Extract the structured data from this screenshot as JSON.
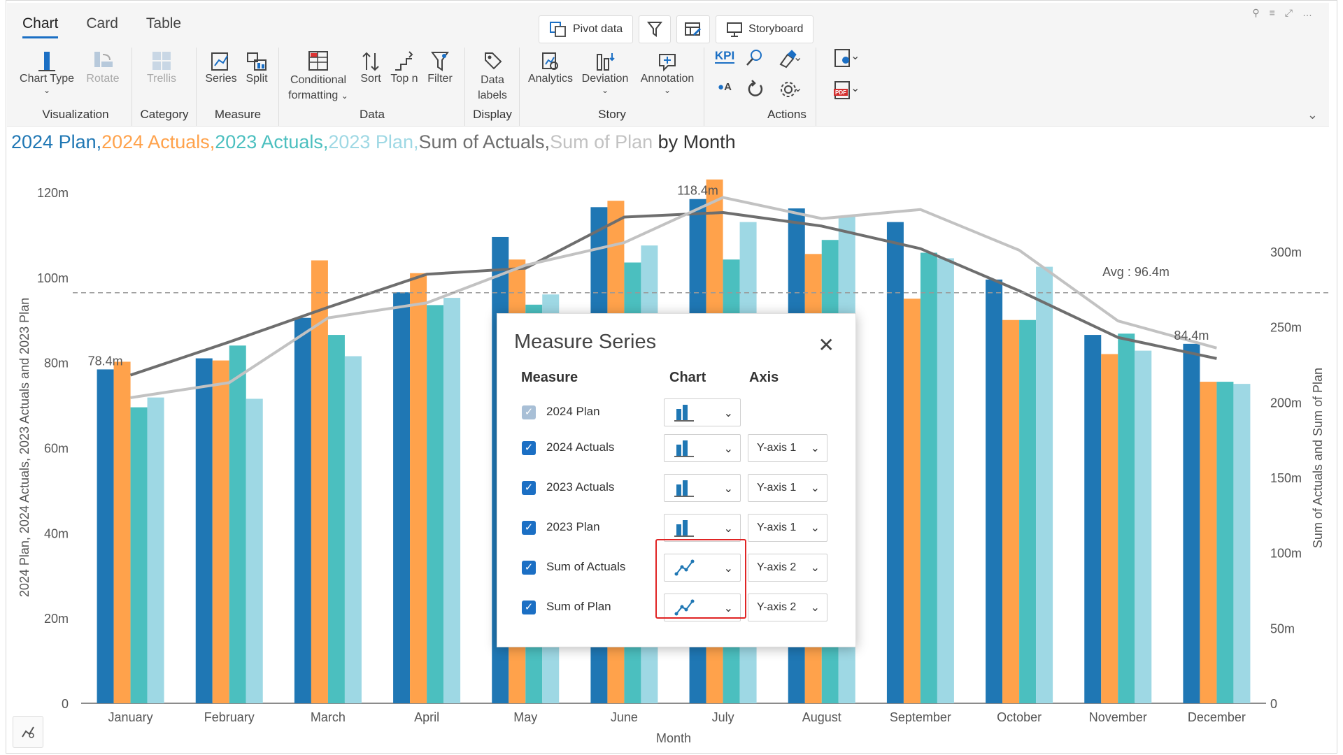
{
  "tabs": [
    "Chart",
    "Card",
    "Table"
  ],
  "top_buttons": {
    "pivot": "Pivot data",
    "storyboard": "Storyboard"
  },
  "ribbon": {
    "chart_type": "Chart Type",
    "rotate": "Rotate",
    "trellis": "Trellis",
    "series": "Series",
    "split": "Split",
    "conditional": "Conditional",
    "formatting": "formatting",
    "sort": "Sort",
    "topn": "Top n",
    "filter": "Filter",
    "data": "Data",
    "labels": "labels",
    "analytics": "Analytics",
    "deviation": "Deviation",
    "annotation": "Annotation",
    "kpi": "KPI",
    "groups": {
      "visualization": "Visualization",
      "category": "Category",
      "measure": "Measure",
      "data": "Data",
      "display": "Display",
      "story": "Story",
      "actions": "Actions"
    }
  },
  "title": {
    "p1": "2024 Plan,",
    "p2": "2024 Actuals,",
    "p3": "2023 Actuals,",
    "p4": "2023 Plan,",
    "p5": "Sum of Actuals,",
    "p6": "Sum of Plan",
    "p7": " by Month"
  },
  "colors": {
    "plan2024": "#1f77b4",
    "actuals2024": "#ffa24b",
    "actuals2023": "#4bbfbf",
    "plan2023": "#9ed8e4",
    "sum_actuals": "#6e6e6e",
    "sum_plan": "#c2c2c2",
    "accent": "#1b6fc4",
    "highlight": "#e02424"
  },
  "chart_data": {
    "type": "bar",
    "categories": [
      "January",
      "February",
      "March",
      "April",
      "May",
      "June",
      "July",
      "August",
      "September",
      "October",
      "November",
      "December"
    ],
    "series": [
      {
        "name": "2024 Plan",
        "axis": "y1",
        "values": [
          78.4,
          81,
          90.5,
          96.5,
          109.5,
          116.5,
          118.4,
          116.2,
          113,
          99.5,
          86.5,
          84.4
        ]
      },
      {
        "name": "2024 Actuals",
        "axis": "y1",
        "values": [
          80.2,
          80.5,
          104,
          101,
          104.2,
          118,
          123,
          105.5,
          95,
          90,
          82,
          75.5
        ]
      },
      {
        "name": "2023 Actuals",
        "axis": "y1",
        "values": [
          69.5,
          84,
          86.5,
          93.5,
          93.6,
          103.5,
          104.2,
          108.8,
          105.8,
          90,
          86.8,
          75.5
        ]
      },
      {
        "name": "2023 Plan",
        "axis": "y1",
        "values": [
          71.8,
          71.5,
          81.5,
          95.2,
          96,
          107.5,
          113,
          114.5,
          104.5,
          102.5,
          82.8,
          75
        ]
      },
      {
        "name": "Sum of Actuals",
        "axis": "y2",
        "type": "line",
        "values": [
          218,
          240,
          263,
          285,
          289,
          323,
          326,
          317,
          302,
          274,
          243,
          229
        ]
      },
      {
        "name": "Sum of Plan",
        "axis": "y2",
        "type": "line",
        "values": [
          203,
          213,
          256,
          266,
          291,
          306,
          336,
          322,
          328,
          301,
          254,
          236
        ]
      }
    ],
    "xlabel": "Month",
    "ylabel": "2024 Plan, 2024 Actuals, 2023 Actuals and 2023 Plan",
    "y2label": "Sum of Actuals and Sum of Plan",
    "y_ticks": [
      "0",
      "20m",
      "40m",
      "60m",
      "80m",
      "100m",
      "120m"
    ],
    "y2_ticks": [
      "0",
      "50m",
      "100m",
      "150m",
      "200m",
      "250m",
      "300m"
    ],
    "ylim": [
      0,
      120
    ],
    "y2lim": [
      0,
      300
    ],
    "avg_line": {
      "value": 96.4,
      "label": "Avg : 96.4m"
    },
    "data_labels": [
      {
        "series": "2024 Plan",
        "category": "January",
        "text": "78.4m"
      },
      {
        "series": "2024 Plan",
        "category": "July",
        "text": "118.4m"
      },
      {
        "series": "2024 Plan",
        "category": "December",
        "text": "84.4m"
      }
    ]
  },
  "dialog": {
    "title": "Measure Series",
    "col_measure": "Measure",
    "col_chart": "Chart",
    "col_axis": "Axis",
    "rows": [
      {
        "label": "2024 Plan",
        "chart": "bar",
        "axis": ""
      },
      {
        "label": "2024 Actuals",
        "chart": "bar",
        "axis": "Y-axis 1"
      },
      {
        "label": "2023 Actuals",
        "chart": "bar",
        "axis": "Y-axis 1"
      },
      {
        "label": "2023 Plan",
        "chart": "bar",
        "axis": "Y-axis 1"
      },
      {
        "label": "Sum of Actuals",
        "chart": "line",
        "axis": "Y-axis 2"
      },
      {
        "label": "Sum of Plan",
        "chart": "line",
        "axis": "Y-axis 2"
      }
    ]
  }
}
